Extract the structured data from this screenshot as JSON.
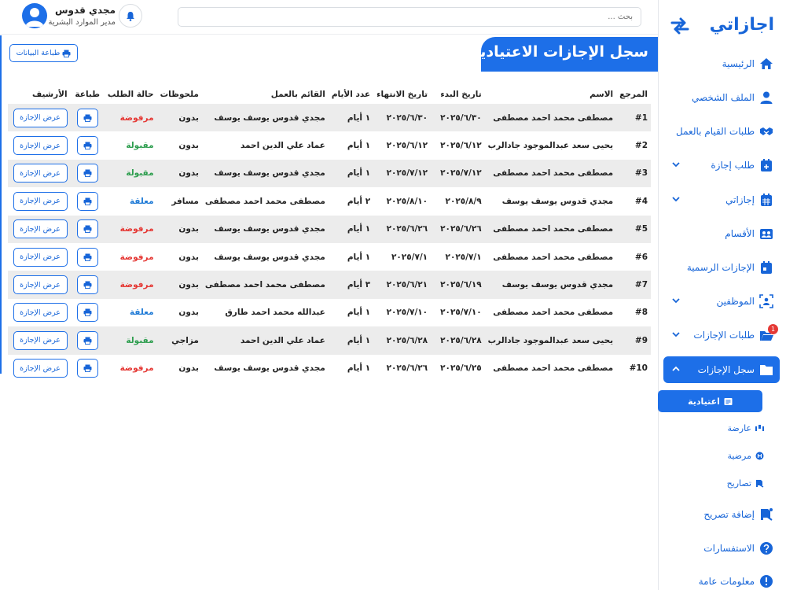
{
  "sidebar": {
    "brand": "اجازاتي",
    "items": [
      {
        "label": "الرئيسية"
      },
      {
        "label": "الملف الشخصي"
      },
      {
        "label": "طلبات القيام بالعمل"
      },
      {
        "label": "طلب إجازة"
      },
      {
        "label": "إجازاتي"
      },
      {
        "label": "الأقسام"
      },
      {
        "label": "الإجازات الرسمية"
      },
      {
        "label": "الموظفين"
      },
      {
        "label": "طلبات الإجازات",
        "badge": "1"
      },
      {
        "label": "سجل الإجازات"
      }
    ],
    "sub_items": [
      {
        "label": "اعتيادية"
      },
      {
        "label": "عارضة"
      },
      {
        "label": "مرضية"
      },
      {
        "label": "تصاريح"
      }
    ],
    "bottom_items": [
      {
        "label": "إضافة تصريح"
      },
      {
        "label": "الاستفسارات"
      },
      {
        "label": "معلومات عامة"
      }
    ]
  },
  "header": {
    "search_placeholder": "بحث ...",
    "user_name": "مجدي قدوس",
    "user_role": "مدير الموارد البشرية"
  },
  "page": {
    "title": "سجل الإجازات الاعتيادية",
    "print_data_label": "طباعة البيانات"
  },
  "table": {
    "headers": [
      "المرجع",
      "الاسم",
      "تاريخ البدء",
      "تاريخ الانتهاء",
      "عدد الأيام",
      "القائم بالعمل",
      "ملحوظات",
      "حالة الطلب",
      "طباعة",
      "الأرشيف"
    ],
    "view_label": "عرض الإجازة",
    "rows": [
      {
        "ref": "#1",
        "name": "مصطفى محمد احمد مصطفى",
        "start": "٢٠٢٥/٦/٣٠",
        "end": "٢٠٢٥/٦/٣٠",
        "days": "١ أيام",
        "substitute": "مجدي قدوس يوسف يوسف",
        "notes": "بدون",
        "status": "مرفوضة",
        "status_key": "rejected"
      },
      {
        "ref": "#2",
        "name": "يحيى سعد عبدالموجود جادالرب",
        "start": "٢٠٢٥/٦/١٢",
        "end": "٢٠٢٥/٦/١٢",
        "days": "١ أيام",
        "substitute": "عماد علي الدين احمد",
        "notes": "بدون",
        "status": "مقبولة",
        "status_key": "accepted"
      },
      {
        "ref": "#3",
        "name": "مصطفى محمد احمد مصطفى",
        "start": "٢٠٢٥/٧/١٢",
        "end": "٢٠٢٥/٧/١٢",
        "days": "١ أيام",
        "substitute": "مجدي قدوس يوسف يوسف",
        "notes": "بدون",
        "status": "مقبولة",
        "status_key": "accepted"
      },
      {
        "ref": "#4",
        "name": "مجدي قدوس يوسف يوسف",
        "start": "٢٠٢٥/٨/٩",
        "end": "٢٠٢٥/٨/١٠",
        "days": "٢ أيام",
        "substitute": "مصطفى محمد احمد مصطفى",
        "notes": "مسافر",
        "status": "معلقة",
        "status_key": "pending"
      },
      {
        "ref": "#5",
        "name": "مصطفى محمد احمد مصطفى",
        "start": "٢٠٢٥/٦/٢٦",
        "end": "٢٠٢٥/٦/٢٦",
        "days": "١ أيام",
        "substitute": "مجدي قدوس يوسف يوسف",
        "notes": "بدون",
        "status": "مرفوضة",
        "status_key": "rejected"
      },
      {
        "ref": "#6",
        "name": "مصطفى محمد احمد مصطفى",
        "start": "٢٠٢٥/٧/١",
        "end": "٢٠٢٥/٧/١",
        "days": "١ أيام",
        "substitute": "مجدي قدوس يوسف يوسف",
        "notes": "بدون",
        "status": "مرفوضة",
        "status_key": "rejected"
      },
      {
        "ref": "#7",
        "name": "مجدي قدوس يوسف يوسف",
        "start": "٢٠٢٥/٦/١٩",
        "end": "٢٠٢٥/٦/٢١",
        "days": "٣ أيام",
        "substitute": "مصطفى محمد احمد مصطفى",
        "notes": "بدون",
        "status": "مرفوضة",
        "status_key": "rejected"
      },
      {
        "ref": "#8",
        "name": "مصطفى محمد احمد مصطفى",
        "start": "٢٠٢٥/٧/١٠",
        "end": "٢٠٢٥/٧/١٠",
        "days": "١ أيام",
        "substitute": "عبدالله محمد احمد طارق",
        "notes": "بدون",
        "status": "معلقة",
        "status_key": "pending"
      },
      {
        "ref": "#9",
        "name": "يحيى سعد عبدالموجود جادالرب",
        "start": "٢٠٢٥/٦/٢٨",
        "end": "٢٠٢٥/٦/٢٨",
        "days": "١ أيام",
        "substitute": "عماد علي الدين احمد",
        "notes": "مزاجي",
        "status": "مقبولة",
        "status_key": "accepted"
      },
      {
        "ref": "#10",
        "name": "مصطفى محمد احمد مصطفى",
        "start": "٢٠٢٥/٦/٢٥",
        "end": "٢٠٢٥/٦/٢٦",
        "days": "١ أيام",
        "substitute": "مجدي قدوس يوسف يوسف",
        "notes": "بدون",
        "status": "مرفوضة",
        "status_key": "rejected"
      }
    ]
  },
  "colors": {
    "primary": "#1d6fe8",
    "rejected": "#e53935",
    "accepted": "#2e9e4f",
    "pending": "#1e7ad6"
  },
  "icons": [
    "swap-arrows-icon",
    "home-icon",
    "user-icon",
    "handshake-icon",
    "calendar-plus-icon",
    "calendar-icon",
    "users-icon",
    "calendar-day-icon",
    "user-group-icon",
    "folder-open-icon",
    "folder-icon",
    "printer-icon",
    "bell-icon",
    "add-permit-icon",
    "question-icon",
    "info-icon"
  ]
}
